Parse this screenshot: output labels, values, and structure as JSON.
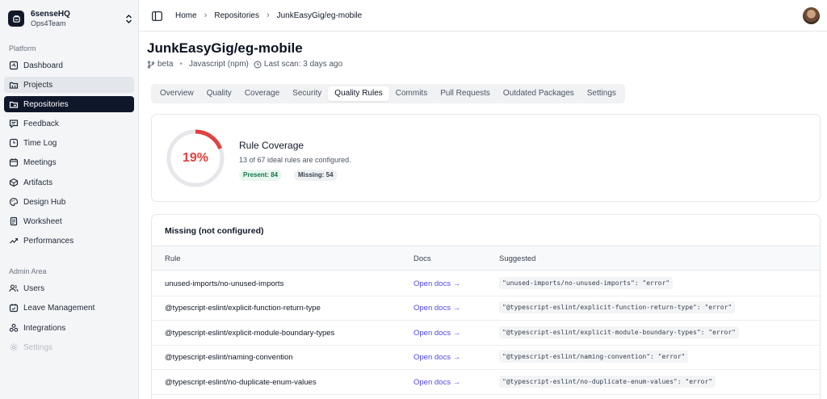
{
  "org": {
    "name": "6senseHQ",
    "team": "Ops4Team"
  },
  "sidebar": {
    "platform_label": "Platform",
    "admin_label": "Admin Area",
    "platform_items": [
      {
        "label": "Dashboard",
        "icon": "dashboard-icon"
      },
      {
        "label": "Projects",
        "icon": "projects-icon"
      },
      {
        "label": "Repositories",
        "icon": "repositories-icon"
      },
      {
        "label": "Feedback",
        "icon": "feedback-icon"
      },
      {
        "label": "Time Log",
        "icon": "clock-icon"
      },
      {
        "label": "Meetings",
        "icon": "calendar-icon"
      },
      {
        "label": "Artifacts",
        "icon": "artifacts-icon"
      },
      {
        "label": "Design Hub",
        "icon": "palette-icon"
      },
      {
        "label": "Worksheet",
        "icon": "worksheet-icon"
      },
      {
        "label": "Performances",
        "icon": "trend-icon"
      }
    ],
    "admin_items": [
      {
        "label": "Users",
        "icon": "users-icon"
      },
      {
        "label": "Leave Management",
        "icon": "calendar-check-icon"
      },
      {
        "label": "Integrations",
        "icon": "integrations-icon"
      },
      {
        "label": "Settings",
        "icon": "gear-icon"
      }
    ]
  },
  "breadcrumb": {
    "home": "Home",
    "repositories": "Repositories",
    "current": "JunkEasyGig/eg-mobile"
  },
  "repo": {
    "title": "JunkEasyGig/eg-mobile",
    "branch": "beta",
    "language": "Javascript (npm)",
    "last_scan": "Last scan: 3 days ago"
  },
  "tabs": [
    "Overview",
    "Quality",
    "Coverage",
    "Security",
    "Quality Rules",
    "Commits",
    "Pull Requests",
    "Outdated Packages",
    "Settings"
  ],
  "active_tab": "Quality Rules",
  "coverage": {
    "percent_label": "19%",
    "percent_value": 19,
    "title": "Rule Coverage",
    "subtitle": "13 of 67 ideal rules are configured.",
    "present": "Present: 84",
    "missing": "Missing: 54",
    "accent_color": "#e0433f",
    "track_color": "#e5e7eb"
  },
  "missing_table": {
    "title": "Missing (not configured)",
    "headers": {
      "rule": "Rule",
      "docs": "Docs",
      "suggested": "Suggested"
    },
    "rows": [
      {
        "rule": "unused-imports/no-unused-imports",
        "docs": "Open docs →",
        "suggested": "\"unused-imports/no-unused-imports\": \"error\""
      },
      {
        "rule": "@typescript-eslint/explicit-function-return-type",
        "docs": "Open docs →",
        "suggested": "\"@typescript-eslint/explicit-function-return-type\": \"error\""
      },
      {
        "rule": "@typescript-eslint/explicit-module-boundary-types",
        "docs": "Open docs →",
        "suggested": "\"@typescript-eslint/explicit-module-boundary-types\": \"error\""
      },
      {
        "rule": "@typescript-eslint/naming-convention",
        "docs": "Open docs →",
        "suggested": "\"@typescript-eslint/naming-convention\": \"error\""
      },
      {
        "rule": "@typescript-eslint/no-duplicate-enum-values",
        "docs": "Open docs →",
        "suggested": "\"@typescript-eslint/no-duplicate-enum-values\": \"error\""
      }
    ]
  }
}
